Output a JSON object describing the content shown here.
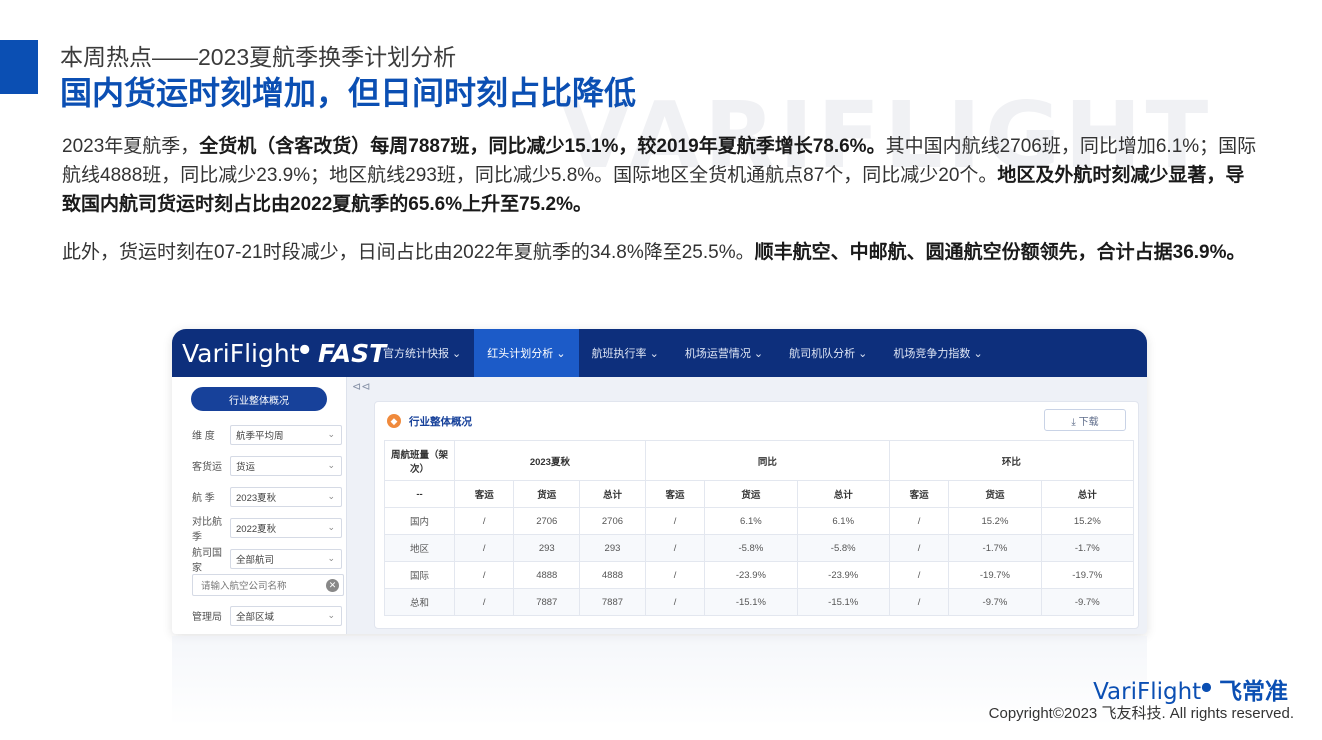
{
  "slide": {
    "kicker": "本周热点——2023夏航季换季计划分析",
    "headline": "国内货运时刻增加，但日间时刻占比降低",
    "watermark": "VARIFLIGHT",
    "accent_color": "#0b4fb3",
    "para1": {
      "s1": "2023年夏航季，",
      "b1": "全货机（含客改货）每周7887班，同比减少15.1%，较2019年夏航季增长78.6%。",
      "s2": "其中国内航线2706班，同比增加6.1%；国际航线4888班，同比减少23.9%；地区航线293班，同比减少5.8%。国际地区全货机通航点87个，同比减少20个。",
      "b2": "地区及外航时刻减少显著，导致国内航司货运时刻占比由2022夏航季的65.6%上升至75.2%。"
    },
    "para2": {
      "s1": "此外，货运时刻在07-21时段减少，日间占比由2022年夏航季的34.8%降至25.5%。",
      "b1": "顺丰航空、中邮航、圆通航空份额领先，合计占据36.9%。"
    },
    "brand_en": "VariFlight",
    "brand_cn": "飞常准",
    "copyright": "Copyright©2023 飞友科技. All rights reserved."
  },
  "app": {
    "logo_main": "VariFlight",
    "logo_fast": "FAST",
    "nav": [
      {
        "label": "官方统计快报 ⌄"
      },
      {
        "label": "红头计划分析 ⌄",
        "active": true
      },
      {
        "label": "航班执行率 ⌄"
      },
      {
        "label": "机场运营情况 ⌄"
      },
      {
        "label": "航司机队分析 ⌄"
      },
      {
        "label": "机场竞争力指数 ⌄"
      }
    ],
    "sidebar": {
      "title": "行业整体概况",
      "filters": [
        {
          "label": "维 度",
          "value": "航季平均周"
        },
        {
          "label": "客货运",
          "value": "货运"
        },
        {
          "label": "航 季",
          "value": "2023夏秋"
        },
        {
          "label": "对比航季",
          "value": "2022夏秋"
        },
        {
          "label": "航司国家",
          "value": "全部航司"
        }
      ],
      "search_placeholder": "请输入航空公司名称",
      "last_filter": {
        "label": "管理局",
        "value": "全部区域"
      }
    },
    "panel": {
      "title": "行业整体概况",
      "download_label": "⤓ 下载",
      "table": {
        "corner": "周航班量（架次）",
        "groups": [
          "2023夏秋",
          "同比",
          "环比"
        ],
        "subheaders": [
          "--",
          "客运",
          "货运",
          "总计",
          "客运",
          "货运",
          "总计",
          "客运",
          "货运",
          "总计"
        ],
        "rows": [
          [
            "国内",
            "/",
            "2706",
            "2706",
            "/",
            "6.1%",
            "6.1%",
            "/",
            "15.2%",
            "15.2%"
          ],
          [
            "地区",
            "/",
            "293",
            "293",
            "/",
            "-5.8%",
            "-5.8%",
            "/",
            "-1.7%",
            "-1.7%"
          ],
          [
            "国际",
            "/",
            "4888",
            "4888",
            "/",
            "-23.9%",
            "-23.9%",
            "/",
            "-19.7%",
            "-19.7%"
          ],
          [
            "总和",
            "/",
            "7887",
            "7887",
            "/",
            "-15.1%",
            "-15.1%",
            "/",
            "-9.7%",
            "-9.7%"
          ]
        ]
      }
    }
  }
}
